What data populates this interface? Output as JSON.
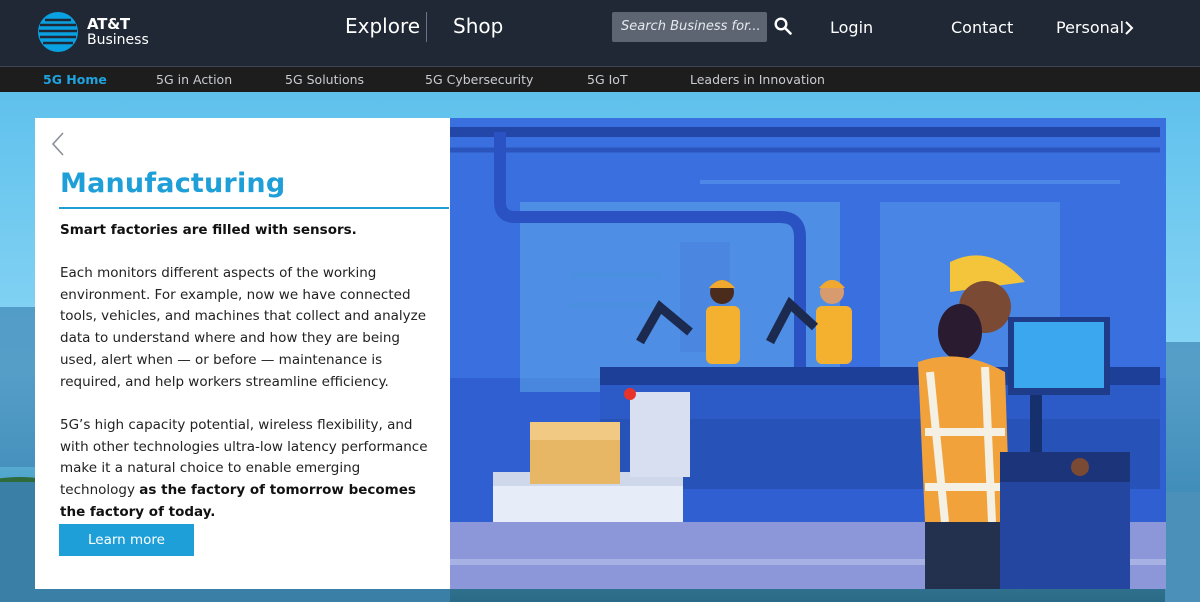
{
  "header": {
    "brand_line1": "AT&T",
    "brand_line2": "Business",
    "nav_explore": "Explore",
    "nav_shop": "Shop",
    "search_placeholder": "Search Business for...",
    "login": "Login",
    "contact": "Contact",
    "personal": "Personal"
  },
  "icons": {
    "logo": "globe-icon",
    "search": "search-icon",
    "chevron": "chevron-right-icon",
    "back": "chevron-left-icon"
  },
  "subnav": {
    "items": [
      {
        "label": "5G Home",
        "active": true
      },
      {
        "label": "5G in Action",
        "active": false
      },
      {
        "label": "5G Solutions",
        "active": false
      },
      {
        "label": "5G Cybersecurity",
        "active": false
      },
      {
        "label": "5G IoT",
        "active": false
      },
      {
        "label": "Leaders in Innovation",
        "active": false
      }
    ]
  },
  "card": {
    "title": "Manufacturing",
    "lead": "Smart factories are filled with sensors.",
    "paragraph1": "Each monitors different aspects of the working environment. For example, now we have connected tools, vehicles, and machines that collect and analyze data to understand where and how they are being used, alert when — or before — maintenance is required, and help workers streamline efficiency.",
    "paragraph2_plain": "5G’s  high capacity potential, wireless flexibility, and with other technologies ultra-low latency performance make it a natural choice to enable emerging technology ",
    "paragraph2_bold": "as the factory of tomorrow becomes the factory of today.",
    "cta": "Learn more"
  },
  "colors": {
    "accent": "#1e9fd8",
    "header_bg": "#1f2834",
    "subnav_bg": "#1d1d1d"
  }
}
